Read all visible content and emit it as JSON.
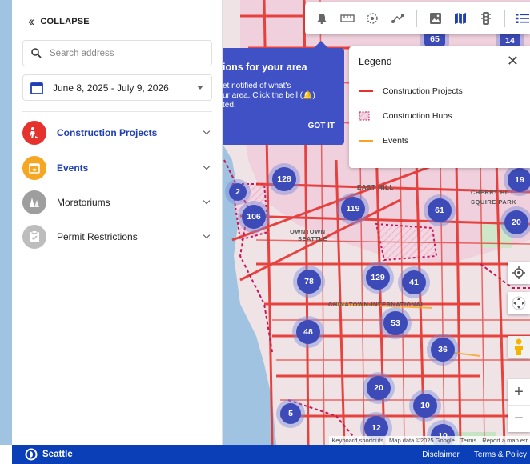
{
  "sidebar": {
    "collapse_label": "COLLAPSE",
    "search_placeholder": "Search address",
    "date_range": "June 8, 2025 - July 9, 2026",
    "layers": [
      {
        "label": "Construction Projects",
        "icon": "construction-worker-icon",
        "color": "#e5322d",
        "active": true
      },
      {
        "label": "Events",
        "icon": "calendar-star-icon",
        "color": "#f5a623",
        "active": false
      },
      {
        "label": "Moratoriums",
        "icon": "cones-icon",
        "color": "#9e9e9e",
        "active": false
      },
      {
        "label": "Permit Restrictions",
        "icon": "clipboard-check-icon",
        "color": "#bdbdbd",
        "active": false
      }
    ]
  },
  "notification": {
    "title": "ions for your area",
    "body": "et notified of what's\nur area. Click the bell (🔔)\nted.",
    "got_it": "GOT IT"
  },
  "legend": {
    "title": "Legend",
    "items": [
      {
        "label": "Construction Projects",
        "type": "line",
        "color": "#e5322d"
      },
      {
        "label": "Construction Hubs",
        "type": "hatch",
        "color": "#c2185b"
      },
      {
        "label": "Events",
        "type": "line",
        "color": "#f5a623"
      }
    ]
  },
  "map": {
    "clusters": [
      "128",
      "2",
      "106",
      "119",
      "61",
      "19",
      "20",
      "78",
      "129",
      "41",
      "53",
      "48",
      "36",
      "20",
      "10",
      "5",
      "12",
      "10",
      "65",
      "14"
    ],
    "labels": [
      "EAST HILL",
      "CHERRY HILL",
      "SQUIRE PARK",
      "OWNTOWN",
      "SEATTLE",
      "CHINATOWN-INTERNATIONAL"
    ],
    "attribution": [
      "Keyboard shortcuts",
      "Map data ©2025 Google",
      "Terms",
      "Report a map err"
    ]
  },
  "footer": {
    "brand": "Seattle",
    "disclaimer": "Disclaimer",
    "terms": "Terms & Policy"
  },
  "colors": {
    "accent": "#3f51c4",
    "footer": "#0a3fb8",
    "road": "#e5322d",
    "event": "#f5a623"
  }
}
